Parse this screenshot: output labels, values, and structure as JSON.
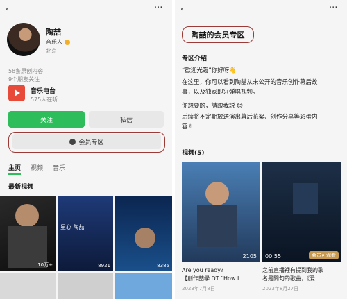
{
  "left": {
    "artist_name": "陶喆",
    "role": "音乐人",
    "location": "北京",
    "original_count": "58条原创内容",
    "following": "9个朋友关注",
    "radio": {
      "title": "音乐电台",
      "listeners": "575人在听"
    },
    "follow_label": "关注",
    "message_label": "私信",
    "member_zone_label": "会员专区",
    "tabs": [
      "主页",
      "视频",
      "音乐"
    ],
    "latest_videos": "最新视频",
    "thumbs": [
      {
        "caption": "",
        "count": "10万+"
      },
      {
        "caption": "星心 陶喆",
        "count": "8921"
      },
      {
        "caption": "",
        "count": "8385"
      }
    ]
  },
  "right": {
    "title": "陶喆的会员专区",
    "intro_heading": "专区介绍",
    "intro_lines": [
      "“歡迎光臨”你好呀👋",
      "在这里，你可以看到陶喆从未公开的音乐创作幕后故",
      "事，以及独家即兴弹唱视频。",
      "你想要的，請跟我説 😊",
      "后续将不定期放送演出幕后花絮、创作分享等彩蛋内",
      "容✌"
    ],
    "videos_heading": "视频(5)",
    "videos": [
      {
        "title": "Are you ready?",
        "subtitle": "【創作喆學 DT “How I ...",
        "date": "2023年7月8日",
        "count": "2105"
      },
      {
        "title": "之前直播裡有提到我的歌",
        "subtitle": "名是問句的歌曲，《爱...",
        "date": "2023年8月27日",
        "count": "00:55",
        "tag": "会员可观看"
      }
    ]
  },
  "colors": {
    "accent_green": "#2dbe5b",
    "highlight_red": "#9b3a36"
  }
}
